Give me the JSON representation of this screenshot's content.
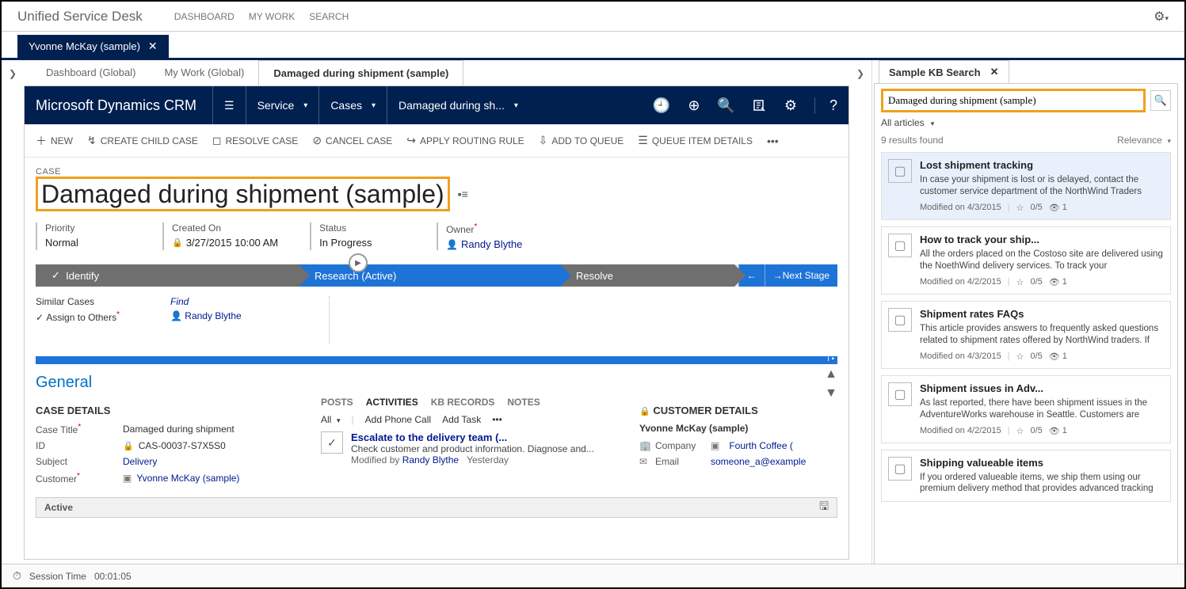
{
  "topbar": {
    "title": "Unified Service Desk",
    "nav": [
      "DASHBOARD",
      "MY WORK",
      "SEARCH"
    ]
  },
  "session_tab": {
    "label": "Yvonne McKay (sample)"
  },
  "view_tabs": {
    "dashboard": "Dashboard (Global)",
    "mywork": "My Work (Global)",
    "active": "Damaged during shipment (sample)"
  },
  "crm_header": {
    "title": "Microsoft Dynamics CRM",
    "service": "Service",
    "cases": "Cases",
    "current": "Damaged during sh..."
  },
  "commands": {
    "new": "NEW",
    "create_child": "CREATE CHILD CASE",
    "resolve": "RESOLVE CASE",
    "cancel": "CANCEL CASE",
    "apply_rule": "APPLY ROUTING RULE",
    "add_queue": "ADD TO QUEUE",
    "queue_details": "QUEUE ITEM DETAILS"
  },
  "record": {
    "type": "CASE",
    "title": "Damaged during shipment (sample)",
    "priority_label": "Priority",
    "priority": "Normal",
    "created_label": "Created On",
    "created": "3/27/2015  10:00 AM",
    "status_label": "Status",
    "status": "In Progress",
    "owner_label": "Owner",
    "owner": "Randy Blythe"
  },
  "stages": {
    "identify": "Identify",
    "research": "Research (Active)",
    "resolve": "Resolve",
    "next": "Next Stage"
  },
  "below": {
    "similar": "Similar Cases",
    "find": "Find",
    "assign_label": "Assign to Others",
    "assign_val": "Randy Blythe"
  },
  "general": {
    "heading": "General",
    "case_details_heading": "CASE DETAILS",
    "case_title_label": "Case Title",
    "case_title_val": "Damaged during shipment",
    "id_label": "ID",
    "id_val": "CAS-00037-S7X5S0",
    "subject_label": "Subject",
    "subject_val": "Delivery",
    "customer_label": "Customer",
    "customer_val": "Yvonne McKay (sample)"
  },
  "activities": {
    "tab_posts": "POSTS",
    "tab_activities": "ACTIVITIES",
    "tab_kb": "KB RECORDS",
    "tab_notes": "NOTES",
    "filter_all": "All",
    "add_call": "Add Phone Call",
    "add_task": "Add Task",
    "item_title": "Escalate to the delivery team (...",
    "item_desc": "Check customer and product information. Diagnose and...",
    "item_modby_label": "Modified by",
    "item_modby_name": "Randy Blythe",
    "item_when": "Yesterday"
  },
  "customer": {
    "heading": "CUSTOMER DETAILS",
    "name": "Yvonne McKay (sample)",
    "company_label": "Company",
    "company_val": "Fourth Coffee (",
    "email_label": "Email",
    "email_val": "someone_a@example"
  },
  "footer": {
    "status": "Active"
  },
  "kb": {
    "tab_label": "Sample KB Search",
    "search_value": "Damaged during shipment (sample)",
    "filter": "All articles",
    "results_text": "9 results found",
    "sort": "Relevance",
    "items": [
      {
        "title": "Lost shipment tracking",
        "desc": "In case your shipment is lost or is delayed, contact the customer service department of the NorthWind Traders",
        "modified": "Modified on 4/3/2015",
        "rating": "0/5",
        "views": "1"
      },
      {
        "title": "How to track your ship...",
        "desc": "All the orders placed on the Costoso site are delivered using the NoethWind delivery services. To track your",
        "modified": "Modified on 4/2/2015",
        "rating": "0/5",
        "views": "1"
      },
      {
        "title": "Shipment rates FAQs",
        "desc": "This article provides answers to frequently asked questions related to shipment rates offered by NorthWind traders. If",
        "modified": "Modified on 4/3/2015",
        "rating": "0/5",
        "views": "1"
      },
      {
        "title": "Shipment issues in Adv...",
        "desc": "As last reported, there have been shipment issues in the AdventureWorks warehouse in Seattle. Customers are",
        "modified": "Modified on 4/2/2015",
        "rating": "0/5",
        "views": "1"
      },
      {
        "title": "Shipping valueable items",
        "desc": "If you ordered valueable items, we ship them using our premium delivery method that provides advanced tracking",
        "modified": "",
        "rating": "",
        "views": ""
      }
    ]
  },
  "statusbar": {
    "label": "Session Time",
    "value": "00:01:05"
  }
}
